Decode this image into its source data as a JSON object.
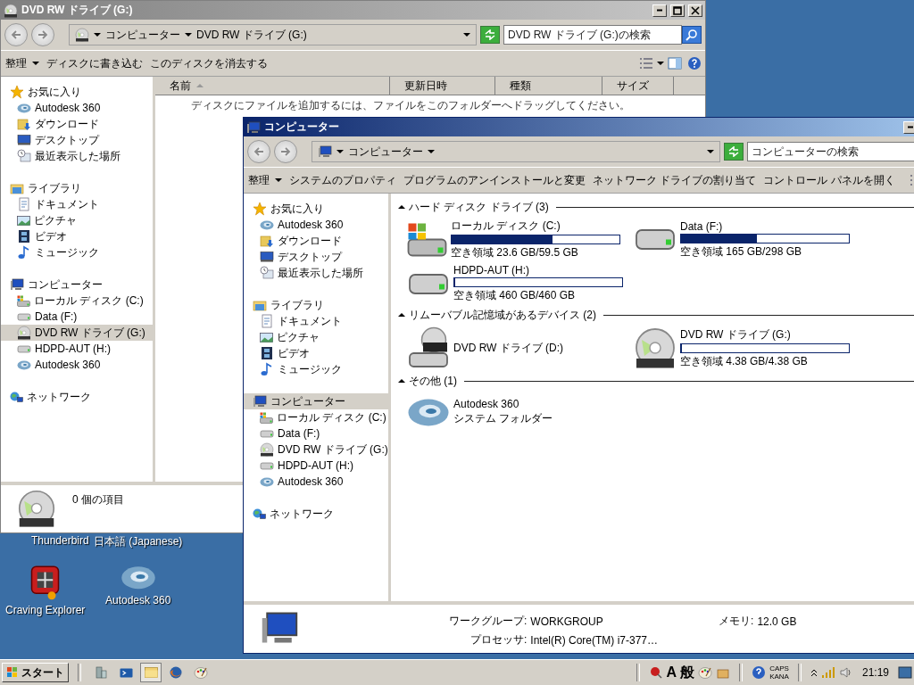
{
  "desktop": {
    "covered_labels": [
      "Thunderbird",
      "日本語 (Japanese)"
    ],
    "icons": [
      {
        "label": "Craving Explorer",
        "kind": "craving"
      },
      {
        "label": "Autodesk 360",
        "kind": "swirl"
      }
    ]
  },
  "windows": [
    {
      "title": "DVD RW ドライブ (G:)",
      "active": false,
      "kind": "disc",
      "breadcrumb": [
        "コンピューター",
        "DVD RW ドライブ (G:)"
      ],
      "search": {
        "placeholder": "DVD RW ドライブ (G:)の検索"
      },
      "organize": "整理",
      "commands": [
        "ディスクに書き込む",
        "このディスクを消去する"
      ],
      "nav": [
        {
          "label": "お気に入り",
          "kind": "star",
          "selected": false,
          "children": [
            {
              "label": "Autodesk 360",
              "kind": "swirl",
              "selected": false
            },
            {
              "label": "ダウンロード",
              "kind": "download",
              "selected": false
            },
            {
              "label": "デスクトップ",
              "kind": "desktop",
              "selected": false
            },
            {
              "label": "最近表示した場所",
              "kind": "recent",
              "selected": false
            }
          ]
        },
        {
          "label": "ライブラリ",
          "kind": "library",
          "selected": false,
          "children": [
            {
              "label": "ドキュメント",
              "kind": "document",
              "selected": false
            },
            {
              "label": "ピクチャ",
              "kind": "picture",
              "selected": false
            },
            {
              "label": "ビデオ",
              "kind": "video",
              "selected": false
            },
            {
              "label": "ミュージック",
              "kind": "music",
              "selected": false
            }
          ]
        },
        {
          "label": "コンピューター",
          "kind": "computer",
          "selected": false,
          "children": [
            {
              "label": "ローカル ディスク (C:)",
              "kind": "windrive",
              "selected": false
            },
            {
              "label": "Data (F:)",
              "kind": "drive",
              "selected": false
            },
            {
              "label": "DVD RW ドライブ (G:)",
              "kind": "disc",
              "selected": true
            },
            {
              "label": "HDPD-AUT (H:)",
              "kind": "drive",
              "selected": false
            },
            {
              "label": "Autodesk 360",
              "kind": "swirl",
              "selected": false
            }
          ]
        },
        {
          "label": "ネットワーク",
          "kind": "network",
          "selected": false
        }
      ],
      "columns": [
        {
          "label": "名前",
          "sorted": true
        },
        {
          "label": "更新日時",
          "sorted": false
        },
        {
          "label": "種類",
          "sorted": false
        },
        {
          "label": "サイズ",
          "sorted": false
        }
      ],
      "hint": "ディスクにファイルを追加するには、ファイルをこのフォルダーへドラッグしてください。",
      "details": {
        "kind": "disc",
        "text": "0 個の項目"
      }
    },
    {
      "title": "コンピューター",
      "active": true,
      "kind": "computer",
      "breadcrumb": [
        "コンピューター"
      ],
      "search": {
        "placeholder": "コンピューターの検索"
      },
      "organize": "整理",
      "commands": [
        "システムのプロパティ",
        "プログラムのアンインストールと変更",
        "ネットワーク ドライブの割り当て",
        "コントロール パネルを開く"
      ],
      "nav": [
        {
          "label": "お気に入り",
          "kind": "star",
          "selected": false,
          "children": [
            {
              "label": "Autodesk 360",
              "kind": "swirl",
              "selected": false
            },
            {
              "label": "ダウンロード",
              "kind": "download",
              "selected": false
            },
            {
              "label": "デスクトップ",
              "kind": "desktop",
              "selected": false
            },
            {
              "label": "最近表示した場所",
              "kind": "recent",
              "selected": false
            }
          ]
        },
        {
          "label": "ライブラリ",
          "kind": "library",
          "selected": false,
          "children": [
            {
              "label": "ドキュメント",
              "kind": "document",
              "selected": false
            },
            {
              "label": "ピクチャ",
              "kind": "picture",
              "selected": false
            },
            {
              "label": "ビデオ",
              "kind": "video",
              "selected": false
            },
            {
              "label": "ミュージック",
              "kind": "music",
              "selected": false
            }
          ]
        },
        {
          "label": "コンピューター",
          "kind": "computer",
          "selected": true,
          "children": [
            {
              "label": "ローカル ディスク (C:)",
              "kind": "windrive",
              "selected": false
            },
            {
              "label": "Data (F:)",
              "kind": "drive",
              "selected": false
            },
            {
              "label": "DVD RW ドライブ (G:)",
              "kind": "disc",
              "selected": false
            },
            {
              "label": "HDPD-AUT (H:)",
              "kind": "drive",
              "selected": false
            },
            {
              "label": "Autodesk 360",
              "kind": "swirl",
              "selected": false
            }
          ]
        },
        {
          "label": "ネットワーク",
          "kind": "network",
          "selected": false
        }
      ],
      "groups": [
        {
          "title": "ハード ディスク ドライブ (3)",
          "expanded": true,
          "items": [
            {
              "name": "ローカル ディスク (C:)",
              "kind": "windrive",
              "level": 0.6,
              "free": "空き領域 23.6 GB/59.5 GB"
            },
            {
              "name": "Data (F:)",
              "kind": "drive",
              "level": 0.45,
              "free": "空き領域 165 GB/298 GB"
            },
            {
              "name": "HDPD-AUT (H:)",
              "kind": "drive",
              "level": 0,
              "free": "空き領域 460 GB/460 GB"
            }
          ]
        },
        {
          "title": "リムーバブル記憶域があるデバイス (2)",
          "expanded": true,
          "items": [
            {
              "name": "DVD RW ドライブ (D:)",
              "kind": "dvddrive"
            },
            {
              "name": "DVD RW ドライブ (G:)",
              "kind": "disc",
              "level": 0,
              "free": "空き領域 4.38 GB/4.38 GB"
            }
          ]
        },
        {
          "title": "その他 (1)",
          "expanded": true,
          "items": [
            {
              "name": "Autodesk 360",
              "kind": "swirl",
              "free": "システム フォルダー"
            }
          ]
        }
      ],
      "details": {
        "kind": "computer",
        "fields": [
          {
            "label": "ワークグループ:",
            "value": "WORKGROUP"
          },
          {
            "label": "メモリ:",
            "value": "12.0 GB"
          },
          {
            "label": "プロセッサ:",
            "value": "Intel(R) Core(TM) i7-377…"
          }
        ]
      }
    }
  ],
  "taskbar": {
    "start": "スタート",
    "quick_launch": [
      {
        "kind": "server",
        "selected": false
      },
      {
        "kind": "powershell",
        "selected": false
      },
      {
        "kind": "explorer",
        "selected": true
      },
      {
        "kind": "firefox",
        "selected": false
      },
      {
        "kind": "paint",
        "selected": false
      }
    ],
    "ime": [
      "A",
      "般"
    ],
    "caps": "CAPS",
    "kana": "KANA",
    "clock": "21:19"
  }
}
